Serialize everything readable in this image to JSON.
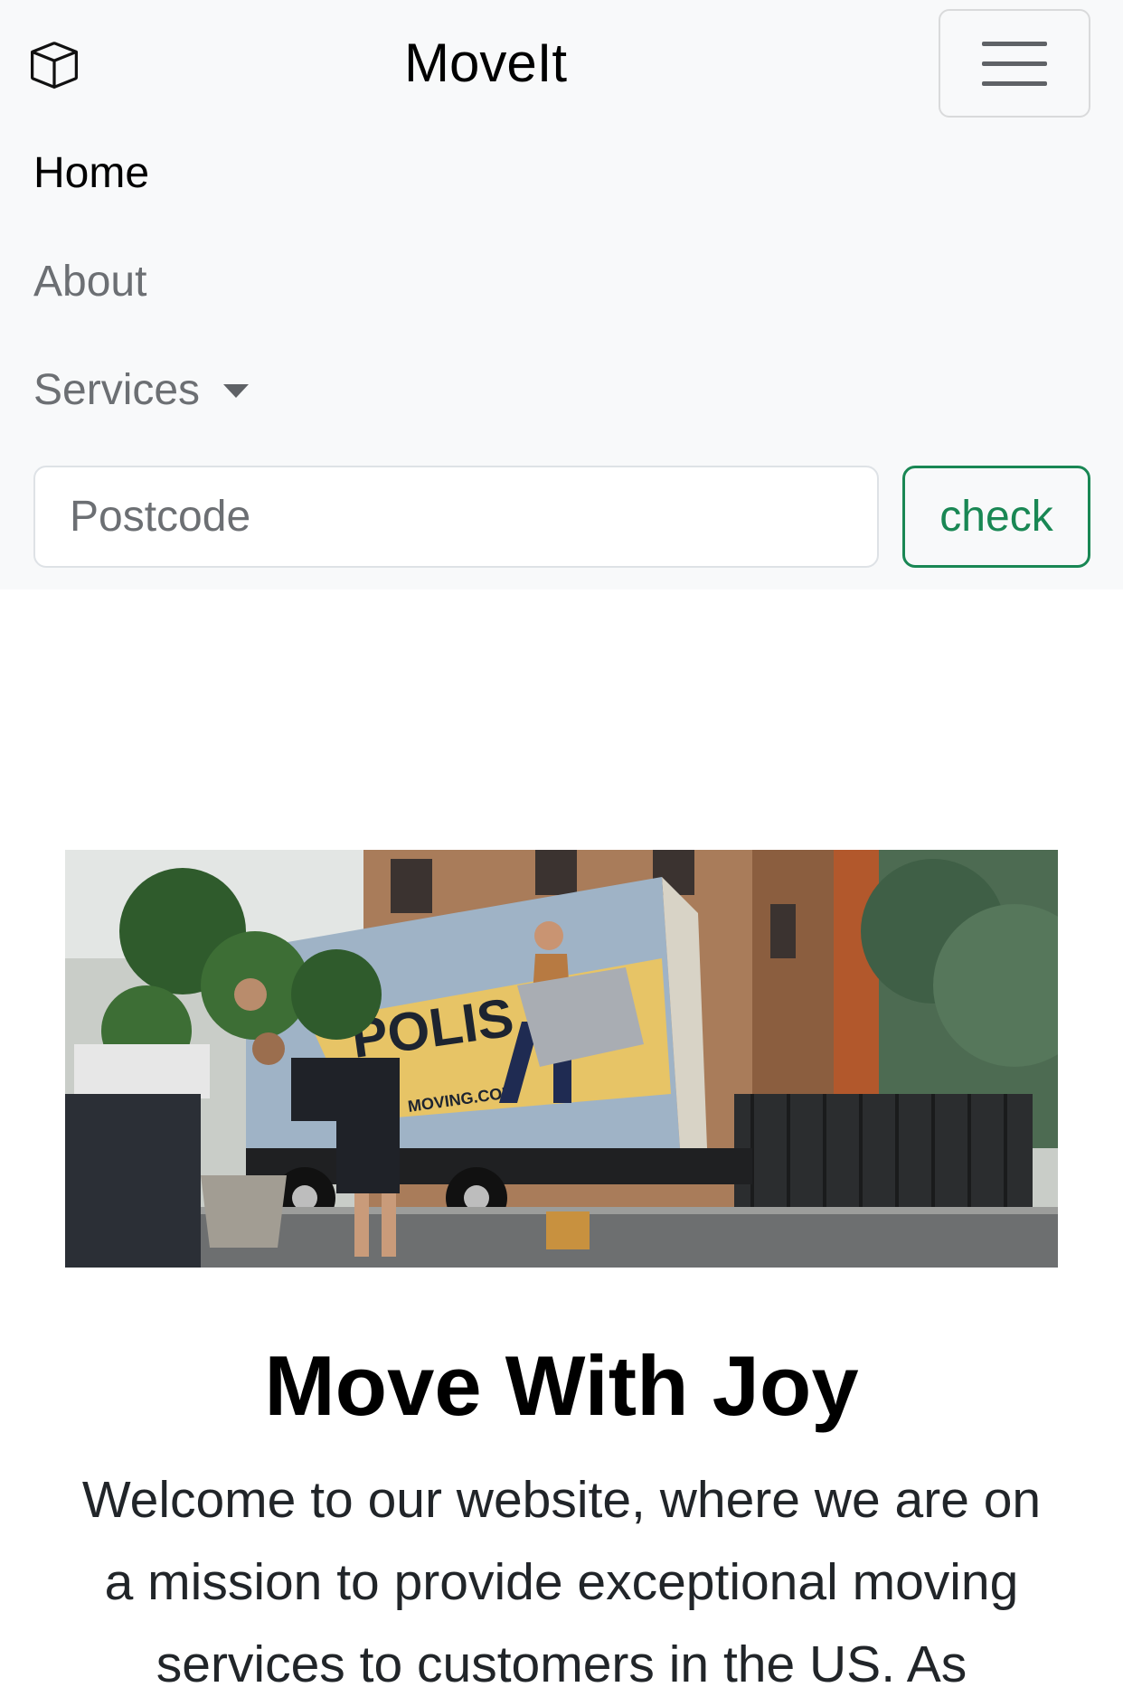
{
  "navbar": {
    "brand_icon": "box-icon",
    "brand_title": "MoveIt",
    "toggler_icon": "hamburger-menu-icon",
    "links": {
      "home": "Home",
      "about": "About",
      "services": "Services"
    },
    "services_caret_icon": "caret-down-icon"
  },
  "search": {
    "placeholder": "Postcode",
    "value": "",
    "button_label": "check"
  },
  "hero": {
    "image_description_icon": "moving-truck-photo",
    "title": "Move With Joy",
    "text": "Welcome to our website, where we are on a mission to provide exceptional moving services to customers in the US. As"
  },
  "colors": {
    "navbar_bg": "#f8f9fa",
    "accent_green": "#198754",
    "muted_text": "#6c6f73"
  }
}
